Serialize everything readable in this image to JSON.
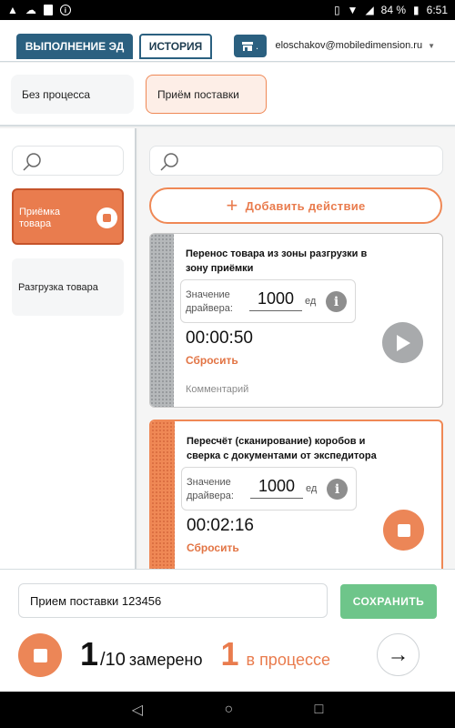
{
  "status_bar": {
    "battery": "84 %",
    "time": "6:51"
  },
  "header": {
    "tab_execution": "ВЫПОЛНЕНИЕ ЭД",
    "tab_history": "ИСТОРИЯ",
    "store_dot": ".",
    "user_email": "eloschakov@mobiledimension.ru"
  },
  "processes": [
    {
      "label": "Без процесса"
    },
    {
      "label": "Приём поставки"
    }
  ],
  "stages": [
    {
      "label": "Приёмка товара"
    },
    {
      "label": "Разгрузка товара"
    }
  ],
  "actions": {
    "add_label": "Добавить действие",
    "items": [
      {
        "title": "Перенос товара из зоны разгрузки в зону приёмки",
        "driver_label": "Значение драйвера:",
        "driver_value": "1000",
        "driver_unit": "ед",
        "timer": "00:00:50",
        "reset_label": "Сбросить",
        "comment_placeholder": "Комментарий"
      },
      {
        "title": "Пересчёт (сканирование) коробов и сверка с документами от экспедитора",
        "driver_label": "Значение драйвера:",
        "driver_value": "1000",
        "driver_unit": "ед",
        "timer": "00:02:16",
        "reset_label": "Сбросить"
      }
    ]
  },
  "footer": {
    "comment_value": "Прием поставки 123456",
    "save_label": "СОХРАНИТЬ",
    "measured_count": "1",
    "measured_total": "/10",
    "measured_label": "замерено",
    "in_progress_count": "1",
    "in_progress_label": "в процессе"
  },
  "colors": {
    "primary": "#2b6080",
    "accent": "#e97c4e",
    "save": "#6ec58a"
  }
}
